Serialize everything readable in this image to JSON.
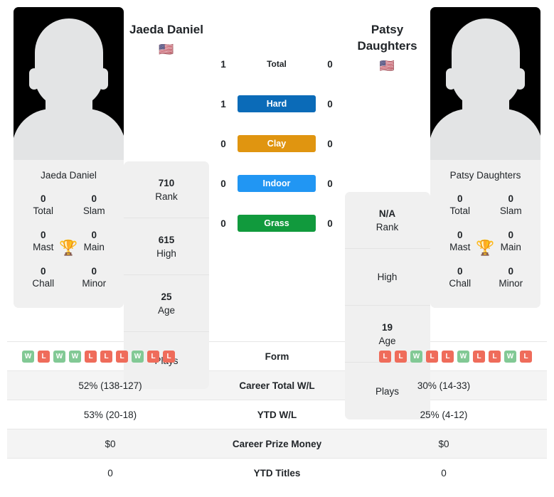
{
  "players": {
    "left": {
      "name": "Jaeda Daniel",
      "flag": "🇺🇸",
      "card_name": "Jaeda Daniel",
      "photo_icon": "player-silhouette",
      "titles": [
        {
          "num": "0",
          "label": "Total"
        },
        {
          "num": "0",
          "label": "Slam"
        },
        {
          "num": "0",
          "label": "Mast"
        },
        {
          "num": "0",
          "label": "Main"
        },
        {
          "num": "0",
          "label": "Chall"
        },
        {
          "num": "0",
          "label": "Minor"
        }
      ],
      "trophy_icon": "trophy-icon",
      "facts": [
        {
          "num": "710",
          "label": "Rank"
        },
        {
          "num": "615",
          "label": "High"
        },
        {
          "num": "25",
          "label": "Age"
        },
        {
          "num": "",
          "label": "Plays"
        }
      ]
    },
    "right": {
      "name": "Patsy Daughters",
      "flag": "🇺🇸",
      "card_name": "Patsy Daughters",
      "photo_icon": "player-silhouette",
      "titles": [
        {
          "num": "0",
          "label": "Total"
        },
        {
          "num": "0",
          "label": "Slam"
        },
        {
          "num": "0",
          "label": "Mast"
        },
        {
          "num": "0",
          "label": "Main"
        },
        {
          "num": "0",
          "label": "Chall"
        },
        {
          "num": "0",
          "label": "Minor"
        }
      ],
      "trophy_icon": "trophy-icon",
      "facts": [
        {
          "num": "N/A",
          "label": "Rank"
        },
        {
          "num": "",
          "label": "High"
        },
        {
          "num": "19",
          "label": "Age"
        },
        {
          "num": "",
          "label": "Plays"
        }
      ]
    }
  },
  "surfaces": [
    {
      "label": "Total",
      "left": "1",
      "right": "0",
      "color": "",
      "plain": true
    },
    {
      "label": "Hard",
      "left": "1",
      "right": "0",
      "color": "#0b6bb8",
      "plain": false
    },
    {
      "label": "Clay",
      "left": "0",
      "right": "0",
      "color": "#e09510",
      "plain": false
    },
    {
      "label": "Indoor",
      "left": "0",
      "right": "0",
      "color": "#2196f3",
      "plain": false
    },
    {
      "label": "Grass",
      "left": "0",
      "right": "0",
      "color": "#119a3d",
      "plain": false
    }
  ],
  "stats": {
    "colors": {
      "win": "#82c995",
      "loss": "#ef6c5b"
    },
    "rows": [
      {
        "label": "Form",
        "type": "form",
        "left_form": [
          "W",
          "L",
          "W",
          "W",
          "L",
          "L",
          "L",
          "W",
          "L",
          "L"
        ],
        "right_form": [
          "L",
          "L",
          "W",
          "L",
          "L",
          "W",
          "L",
          "L",
          "W",
          "L"
        ],
        "striped": false
      },
      {
        "label": "Career Total W/L",
        "type": "text",
        "left": "52% (138-127)",
        "right": "30% (14-33)",
        "striped": true
      },
      {
        "label": "YTD W/L",
        "type": "text",
        "left": "53% (20-18)",
        "right": "25% (4-12)",
        "striped": false
      },
      {
        "label": "Career Prize Money",
        "type": "text",
        "left": "$0",
        "right": "$0",
        "striped": true
      },
      {
        "label": "YTD Titles",
        "type": "text",
        "left": "0",
        "right": "0",
        "striped": false
      }
    ]
  }
}
